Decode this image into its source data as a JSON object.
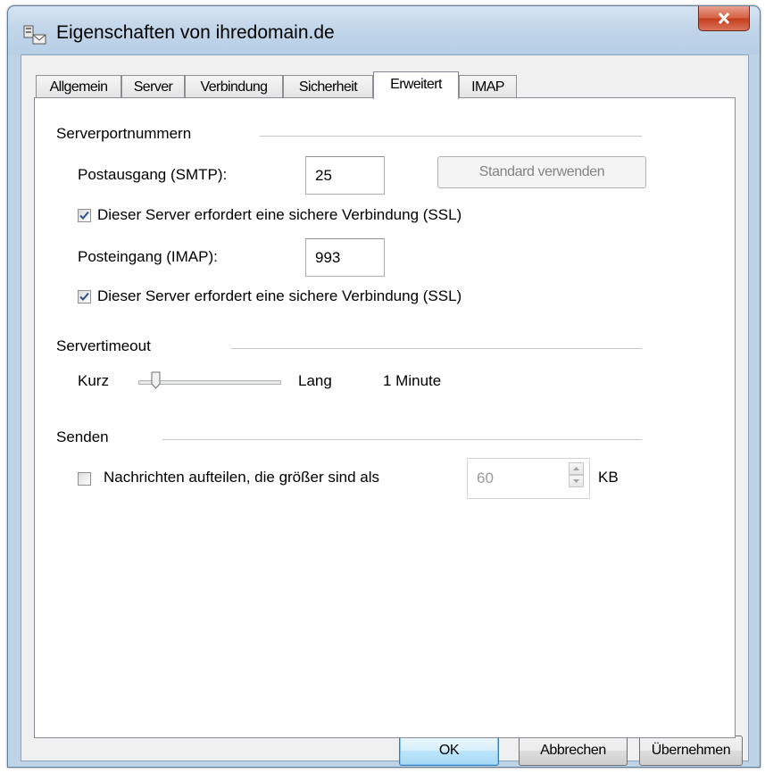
{
  "window": {
    "title": "Eigenschaften von ihredomain.de",
    "close_glyph": "X"
  },
  "tabs": [
    {
      "label": "Allgemein"
    },
    {
      "label": "Server"
    },
    {
      "label": "Verbindung"
    },
    {
      "label": "Sicherheit"
    },
    {
      "label": "Erweitert",
      "active": true
    },
    {
      "label": "IMAP"
    }
  ],
  "serverports": {
    "group_label": "Serverportnummern",
    "smtp_label": "Postausgang (SMTP):",
    "smtp_value": "25",
    "standard_button": "Standard verwenden",
    "smtp_ssl_label": "Dieser Server erfordert eine sichere Verbindung (SSL)",
    "smtp_ssl_checked": true,
    "imap_label": "Posteingang (IMAP):",
    "imap_value": "993",
    "imap_ssl_label": "Dieser Server erfordert eine sichere Verbindung (SSL)",
    "imap_ssl_checked": true
  },
  "timeout": {
    "group_label": "Servertimeout",
    "short_label": "Kurz",
    "long_label": "Lang",
    "value_text": "1 Minute",
    "slider_fraction": 0.1
  },
  "send": {
    "group_label": "Senden",
    "split_label": "Nachrichten aufteilen, die größer sind als",
    "split_checked": false,
    "size_value": "60",
    "unit": "KB"
  },
  "footer": {
    "ok": "OK",
    "cancel": "Abbrechen",
    "apply": "Übernehmen"
  },
  "colors": {
    "close_button": "#c9462a",
    "default_button_border": "#3c7fb1"
  }
}
